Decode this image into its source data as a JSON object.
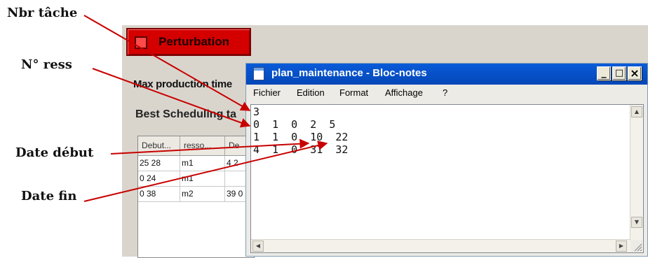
{
  "background_app": {
    "perturbation_button": "Perturbation",
    "max_label": "Max production time",
    "best_label": "Best Scheduling ta",
    "table": {
      "headers": [
        "Debut...",
        "resso...",
        "De"
      ],
      "rows": [
        [
          "25 28",
          "m1",
          "4 2"
        ],
        [
          "0 24",
          "m1",
          ""
        ],
        [
          "0 38",
          "m2",
          "39 0"
        ]
      ]
    }
  },
  "notepad": {
    "title": "plan_maintenance - Bloc-notes",
    "menu": [
      "Fichier",
      "Edition",
      "Format",
      "Affichage",
      "?"
    ],
    "lines": [
      "3",
      "0  1  0  2  5",
      "1  1  0  10  22",
      "4  1  0  31  32"
    ],
    "buttons": {
      "minimize": "_",
      "maximize": "□",
      "close": "×"
    }
  },
  "annotations": {
    "nbr_tache": "Nbr tâche",
    "n_ress": "N° ress",
    "date_debut": "Date début",
    "date_fin": "Date fin"
  },
  "colors": {
    "perturbation_red": "#d40000",
    "titlebar_blue": "#0a5bd8",
    "arrow_red": "#c80000"
  }
}
